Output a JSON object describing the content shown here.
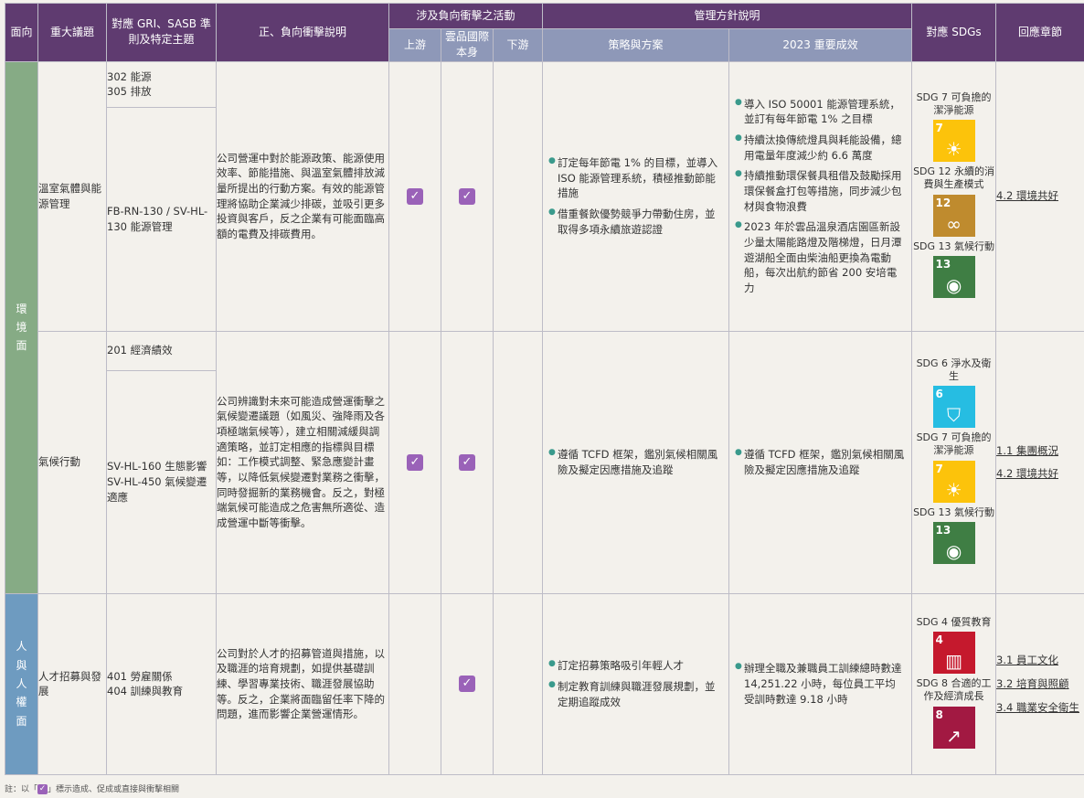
{
  "headers": {
    "face": "面向",
    "topic": "重大議題",
    "gri": "對應 GRI、SASB 準則及特定主題",
    "impact": "正、負向衝擊說明",
    "activity": "涉及負向衝擊之活動",
    "upstream": "上游",
    "self": "雲品國際本身",
    "downstream": "下游",
    "mgmt": "管理方針說明",
    "strategy": "策略與方案",
    "results": "2023 重要成效",
    "sdgs": "對應 SDGs",
    "chapter": "回應章節"
  },
  "faces": {
    "env": "環境面",
    "human": "人與人權面"
  },
  "colors": {
    "header_purple": "#5f3b70",
    "header_blue": "#8e98b8",
    "env_green": "#86ab85",
    "human_blue": "#6e9bc0",
    "check_purple": "#9a62b8",
    "bullet_teal": "#3a9a8c"
  },
  "rows": [
    {
      "topic": "溫室氣體與能源管理",
      "gri_top": [
        "302 能源",
        "305 排放"
      ],
      "gri_bottom": [
        "FB-RN-130 / SV-HL-130 能源管理"
      ],
      "impact": "公司營運中對於能源政策、能源使用效率、節能措施、與溫室氣體排放減量所提出的行動方案。有效的能源管理將協助企業減少排碳，並吸引更多投資與客戶，反之企業有可能面臨高額的電費及排碳費用。",
      "upstream": true,
      "self": true,
      "downstream": false,
      "strategy": [
        "訂定每年節電 1% 的目標，並導入 ISO 能源管理系統，積極推動節能措施",
        "借重餐飲優勢競爭力帶動住房，並取得多項永續旅遊認證"
      ],
      "results": [
        "導入 ISO 50001 能源管理系統，並訂有每年節電 1% 之目標",
        "持續汰換傳統燈具與耗能設備，總用電量年度減少約 6.6 萬度",
        "持續推動環保餐具租借及鼓勵採用環保餐盒打包等措施，同步減少包材與食物浪費",
        "2023 年於雲品溫泉酒店園區新設少量太陽能路燈及階梯燈，日月潭遊湖船全面由柴油船更換為電動船，每次出航約節省 200 安培電力"
      ],
      "sdgs": [
        {
          "label": "SDG 7 可負擔的潔淨能源",
          "num": "7",
          "color": "#fcc30b",
          "icon": "sun-icon"
        },
        {
          "label": "SDG 12 永續的消費與生產模式",
          "num": "12",
          "color": "#bf8b2e",
          "icon": "infinity-icon"
        },
        {
          "label": "SDG 13 氣候行動",
          "num": "13",
          "color": "#3f7e44",
          "icon": "eye-globe-icon"
        }
      ],
      "chapters": [
        "4.2 環境共好"
      ]
    },
    {
      "topic": "氣候行動",
      "gri_top": [
        "201 經濟績效"
      ],
      "gri_bottom": [
        "SV-HL-160 生態影響",
        "SV-HL-450 氣候變遷適應"
      ],
      "impact": "公司辨識對未來可能造成營運衝擊之氣候變遷議題（如風災、強降雨及各項極端氣候等），建立相關減緩與調適策略，並訂定相應的指標與目標如：工作模式調整、緊急應變計畫等，以降低氣候變遷對業務之衝擊，同時發掘新的業務機會。反之，對極端氣候可能造成之危害無所適從、造成營運中斷等衝擊。",
      "upstream": true,
      "self": true,
      "downstream": false,
      "strategy": [
        "遵循 TCFD 框架，鑑別氣候相關風險及擬定因應措施及追蹤"
      ],
      "results": [
        "遵循 TCFD 框架，鑑別氣候相關風險及擬定因應措施及追蹤"
      ],
      "sdgs": [
        {
          "label": "SDG 6 淨水及衛生",
          "num": "6",
          "color": "#26bde2",
          "icon": "water-icon"
        },
        {
          "label": "SDG 7 可負擔的潔淨能源",
          "num": "7",
          "color": "#fcc30b",
          "icon": "sun-icon"
        },
        {
          "label": "SDG 13 氣候行動",
          "num": "13",
          "color": "#3f7e44",
          "icon": "eye-globe-icon"
        }
      ],
      "chapters": [
        "1.1 集團概況",
        "4.2 環境共好"
      ]
    },
    {
      "topic": "人才招募與發展",
      "gri_top": [
        "401 勞雇關係",
        "404 訓練與教育"
      ],
      "impact": "公司對於人才的招募管道與措施，以及職涯的培育規劃，如提供基礎訓練、學習專業技術、職涯發展協助等。反之，企業將面臨留任率下降的問題，進而影響企業營運情形。",
      "upstream": false,
      "self": true,
      "downstream": false,
      "strategy": [
        "訂定招募策略吸引年輕人才",
        "制定教育訓練與職涯發展規劃，並定期追蹤成效"
      ],
      "results": [
        "辦理全職及兼職員工訓練總時數達 14,251.22 小時，每位員工平均受訓時數達 9.18 小時"
      ],
      "sdgs": [
        {
          "label": "SDG 4 優質教育",
          "num": "4",
          "color": "#c5192d",
          "icon": "book-icon"
        },
        {
          "label": "SDG 8 合適的工作及經濟成長",
          "num": "8",
          "color": "#a21942",
          "icon": "growth-chart-icon"
        }
      ],
      "chapters": [
        "3.1 員工文化",
        "3.2 培育與照顧",
        "3.4 職業安全衛生"
      ]
    }
  ],
  "note": {
    "prefix": "註：以「",
    "suffix": "」標示造成、促成或直接與衝擊相關",
    "check": "✓"
  }
}
